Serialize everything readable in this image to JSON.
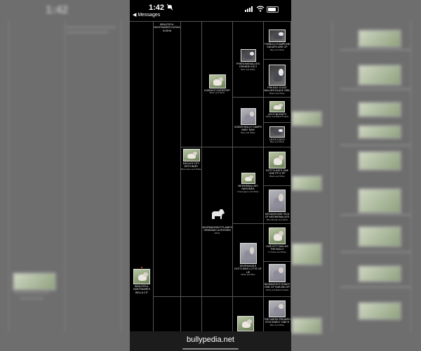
{
  "status": {
    "time": "1:42",
    "back_label": "◀ Messages",
    "battery_level": 0.85,
    "icons": [
      "bell-slash-icon",
      "cellular-signal-icon",
      "wifi-icon",
      "battery-icon"
    ]
  },
  "browser": {
    "url": "bullypedia.net"
  },
  "pedigree": {
    "subject": {
      "name": "BEAUTIFUL NIGHTMARES BELLA CIT"
    },
    "gen1": [
      {
        "name": "BEAUTIFUL NIGHTMARES KUSHA KUSHA"
      }
    ],
    "gen2": [
      {
        "name": "KAYLA'S CITY WITH BABY",
        "meta": "Blue Fawn and White"
      },
      {
        "name": "SKUPMAGNDOTTLANE'S OBSIDIAN LA ROSSINI",
        "meta": "White"
      }
    ],
    "gen3": [
      {
        "name": "KOBOH'S OVERSTEP",
        "meta": "Black and White"
      },
      {
        "name": "MEDWEBALLIES NAHOMEA",
        "meta": "Champagne and White"
      },
      {
        "name": "SKUPMAGN'S DOTTLINES LOTTE OF LIE",
        "meta": "White and Blue"
      }
    ],
    "gen4": [
      {
        "name": "PHENOMENALLIES GRANDE KIS 2",
        "meta": "Blue and White"
      },
      {
        "name": "KOBOH BULLY CAMPS BABY BAM",
        "meta": "Blue and White"
      }
    ],
    "gen5": [
      {
        "name": "THEBULLYCAMPLINE KAKAPO ARE CP",
        "meta": "Blue and White"
      },
      {
        "name": "PRESSIS STATE BULLIES BLACK GIRL",
        "meta": "Black and White"
      },
      {
        "name": "LEX'S BUGATTI",
        "meta": "White and Black Pinatas"
      },
      {
        "name": "LEX'S COCO",
        "meta": "Blue and White"
      },
      {
        "name": "DOTTYLINE'S ONE ONE PP G PP",
        "meta": "Black and White"
      },
      {
        "name": "MCSANGLEAK VICA OF MEDWEBALLIES",
        "meta": "Blue Brindle and White"
      },
      {
        "name": "HUB CITY DALLAS THE BULLY",
        "meta": "Tri Fawn and White"
      },
      {
        "name": "BIGWAGON'S SHADY ONE OF HUB IND GP",
        "meta": "White and Black Pinatas"
      },
      {
        "name": "THE UAESA TRIUMPH STOCKWELT ONE R",
        "meta": "Blue and White"
      }
    ]
  }
}
